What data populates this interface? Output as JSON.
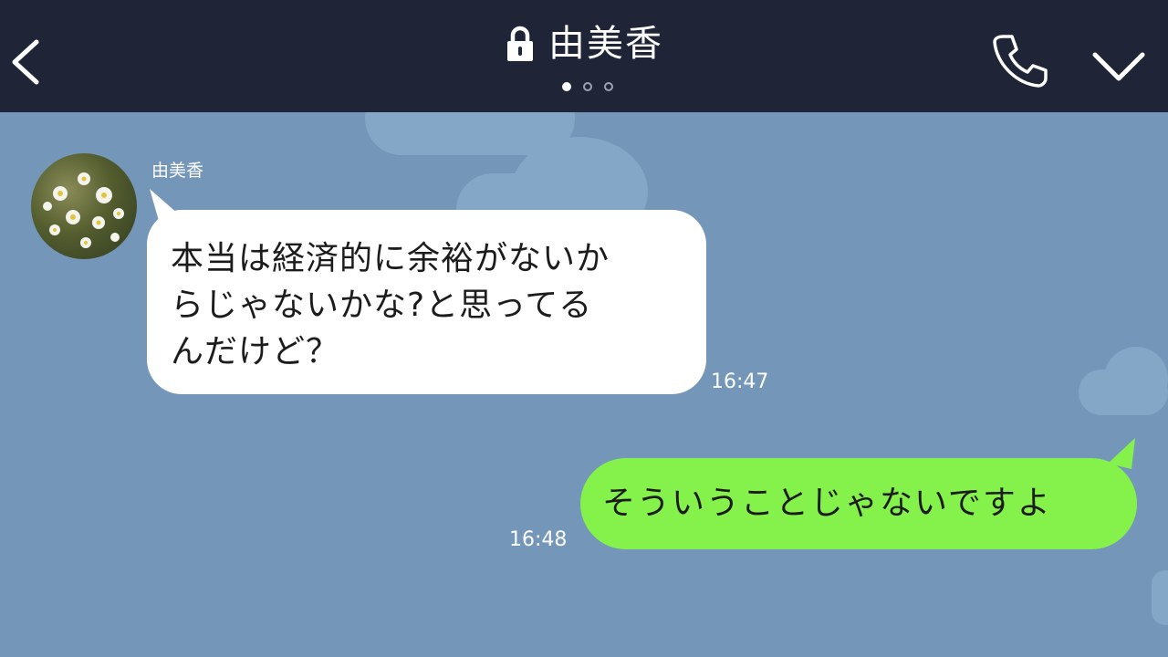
{
  "header": {
    "title": "由美香",
    "back_icon": "chevron-left-icon",
    "lock_icon": "lock-icon",
    "call_icon": "phone-icon",
    "menu_icon": "chevron-down-icon",
    "page_dots": 3,
    "active_dot": 0,
    "background": "#1f2537"
  },
  "chat": {
    "background": "#7497b9",
    "messages": [
      {
        "direction": "incoming",
        "sender": "由美香",
        "text": "本当は経済的に余裕がないか\nらじゃないかな?と思ってる\nんだけど？",
        "time": "16:47",
        "bubble_color": "#ffffff"
      },
      {
        "direction": "outgoing",
        "text": "そういうことじゃないですよ",
        "time": "16:48",
        "bubble_color": "#85f14b"
      }
    ]
  }
}
